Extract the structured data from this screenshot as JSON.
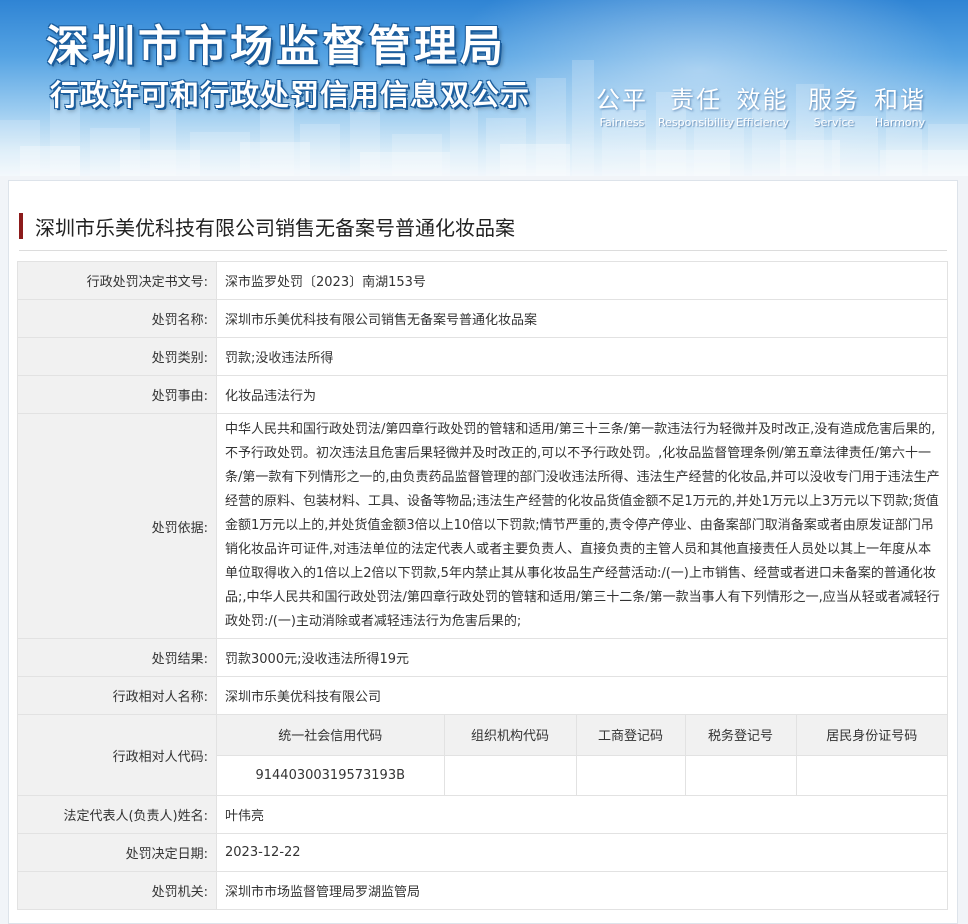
{
  "banner": {
    "title": "深圳市市场监督管理局",
    "subtitle": "行政许可和行政处罚信用信息双公示",
    "values": [
      {
        "zh": "公平",
        "en": "Fairness"
      },
      {
        "zh": "责任",
        "en": "Responsibility"
      },
      {
        "zh": "效能",
        "en": "Efficiency"
      },
      {
        "zh": "服务",
        "en": "Service"
      },
      {
        "zh": "和谐",
        "en": "Harmony"
      }
    ]
  },
  "case_title": "深圳市乐美优科技有限公司销售无备案号普通化妆品案",
  "fields": {
    "doc_no": {
      "label": "行政处罚决定书文号:",
      "value": "深市监罗处罚〔2023〕南湖153号"
    },
    "name": {
      "label": "处罚名称:",
      "value": "深圳市乐美优科技有限公司销售无备案号普通化妆品案"
    },
    "category": {
      "label": "处罚类别:",
      "value": "罚款;没收违法所得"
    },
    "reason": {
      "label": "处罚事由:",
      "value": "化妆品违法行为"
    },
    "basis": {
      "label": "处罚依据:",
      "value": "中华人民共和国行政处罚法/第四章行政处罚的管辖和适用/第三十三条/第一款违法行为轻微并及时改正,没有造成危害后果的,不予行政处罚。初次违法且危害后果轻微并及时改正的,可以不予行政处罚。,化妆品监督管理条例/第五章法律责任/第六十一条/第一款有下列情形之一的,由负责药品监督管理的部门没收违法所得、违法生产经营的化妆品,并可以没收专门用于违法生产经营的原料、包装材料、工具、设备等物品;违法生产经营的化妆品货值金额不足1万元的,并处1万元以上3万元以下罚款;货值金额1万元以上的,并处货值金额3倍以上10倍以下罚款;情节严重的,责令停产停业、由备案部门取消备案或者由原发证部门吊销化妆品许可证件,对违法单位的法定代表人或者主要负责人、直接负责的主管人员和其他直接责任人员处以其上一年度从本单位取得收入的1倍以上2倍以下罚款,5年内禁止其从事化妆品生产经营活动:/(一)上市销售、经营或者进口未备案的普通化妆品;,中华人民共和国行政处罚法/第四章行政处罚的管辖和适用/第三十二条/第一款当事人有下列情形之一,应当从轻或者减轻行政处罚:/(一)主动消除或者减轻违法行为危害后果的;"
    },
    "result": {
      "label": "处罚结果:",
      "value": "罚款3000元;没收违法所得19元"
    },
    "party": {
      "label": "行政相对人名称:",
      "value": "深圳市乐美优科技有限公司"
    },
    "codes": {
      "label": "行政相对人代码:",
      "headers": [
        "统一社会信用代码",
        "组织机构代码",
        "工商登记码",
        "税务登记号",
        "居民身份证号码"
      ],
      "values": [
        "91440300319573193B",
        "",
        "",
        "",
        ""
      ]
    },
    "legal_rep": {
      "label": "法定代表人(负责人)姓名:",
      "value": "叶伟亮"
    },
    "date": {
      "label": "处罚决定日期:",
      "value": "2023-12-22"
    },
    "authority": {
      "label": "处罚机关:",
      "value": "深圳市市场监督管理局罗湖监管局"
    }
  },
  "colors": {
    "title_bar": "#8c1b1b",
    "label_bg": "#f1f1f1",
    "border": "#e2e2e2",
    "banner_sky": "#2f84d4"
  }
}
